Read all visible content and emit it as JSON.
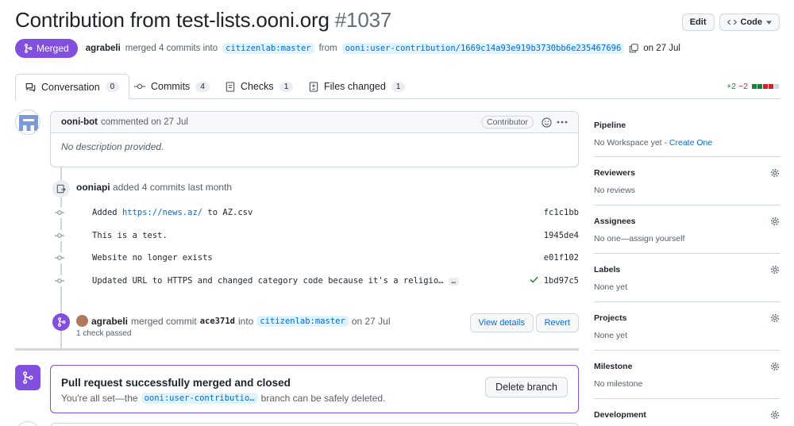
{
  "header": {
    "title": "Contribution from test-lists.ooni.org",
    "number": "#1037",
    "edit_label": "Edit",
    "code_label": "Code"
  },
  "state": {
    "badge": "Merged",
    "author": "agrabeli",
    "text_merged": "merged 4 commits into",
    "base_branch": "citizenlab:master",
    "text_from": "from",
    "head_branch": "ooni:user-contribution/1669c14a93e919b3730bb6e235467696",
    "date": "on 27 Jul"
  },
  "tabs": [
    {
      "label": "Conversation",
      "count": "0"
    },
    {
      "label": "Commits",
      "count": "4"
    },
    {
      "label": "Checks",
      "count": "1"
    },
    {
      "label": "Files changed",
      "count": "1"
    }
  ],
  "diffstat": {
    "add": "+2",
    "del": "−2"
  },
  "comment": {
    "author": "ooni-bot",
    "meta": "commented on 27 Jul",
    "role": "Contributor",
    "body": "No description provided."
  },
  "commits": {
    "author": "ooniapi",
    "text": "added 4 commits last month",
    "items": [
      {
        "msg_pre": "Added ",
        "msg_link": "https://news.az/",
        "msg_post": " to AZ.csv",
        "sha": "fc1c1bb"
      },
      {
        "msg_pre": "This is a test.",
        "msg_link": "",
        "msg_post": "",
        "sha": "1945de4"
      },
      {
        "msg_pre": "Website no longer exists",
        "msg_link": "",
        "msg_post": "",
        "sha": "e01f102"
      },
      {
        "msg_pre": "Updated URL to HTTPS and changed category code because it's a religio…",
        "msg_link": "",
        "msg_post": "",
        "sha": "1bd97c5"
      }
    ],
    "ellipsis": "…"
  },
  "merge_event": {
    "author": "agrabeli",
    "text": "merged commit",
    "sha": "ace371d",
    "into": "into",
    "branch": "citizenlab:master",
    "date": "on 27 Jul",
    "checks": "1 check passed",
    "view_details": "View details",
    "revert": "Revert"
  },
  "merged_box": {
    "title": "Pull request successfully merged and closed",
    "text_pre": "You're all set—the",
    "branch": "ooni:user-contributio…",
    "text_post": "branch can be safely deleted.",
    "button": "Delete branch"
  },
  "sidebar": {
    "pipeline": {
      "title": "Pipeline",
      "value": "No Workspace yet - ",
      "link": "Create One"
    },
    "reviewers": {
      "title": "Reviewers",
      "value": "No reviews"
    },
    "assignees": {
      "title": "Assignees",
      "value": "No one—assign yourself"
    },
    "labels": {
      "title": "Labels",
      "value": "None yet"
    },
    "projects": {
      "title": "Projects",
      "value": "None yet"
    },
    "milestone": {
      "title": "Milestone",
      "value": "No milestone"
    },
    "development": {
      "title": "Development"
    }
  },
  "colors": {
    "merged": "#8250df",
    "link": "#0969da",
    "success": "#1a7f37",
    "danger": "#cf222e"
  }
}
